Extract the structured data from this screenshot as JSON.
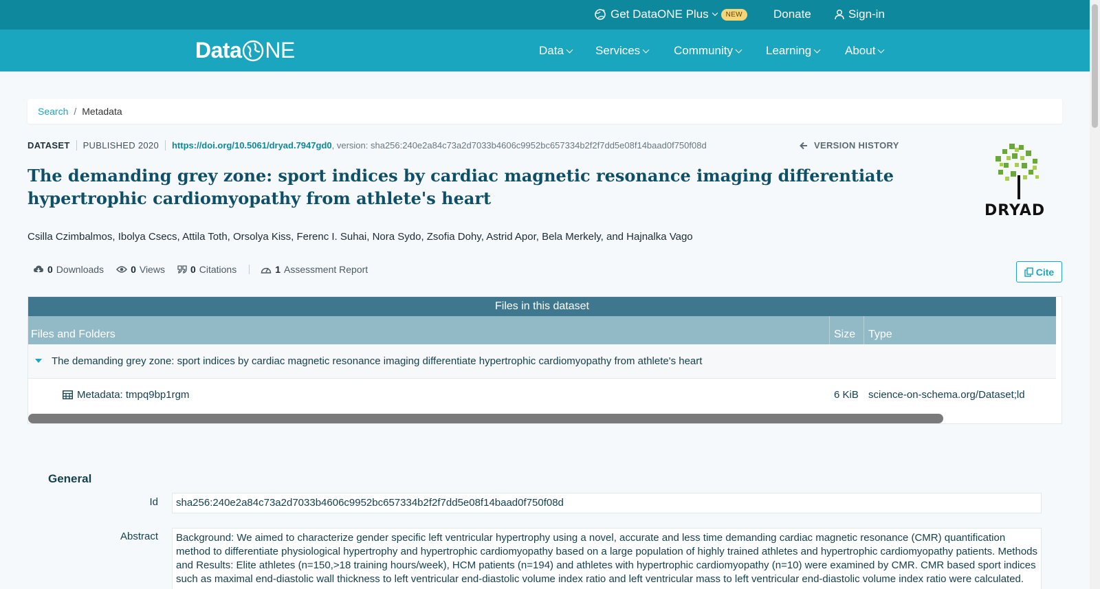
{
  "topbar": {
    "plus_label": "Get DataONE Plus",
    "new_badge": "NEW",
    "donate": "Donate",
    "signin": "Sign-in"
  },
  "nav": {
    "logo_left": "Data",
    "logo_right": "NE",
    "items": [
      "Data",
      "Services",
      "Community",
      "Learning",
      "About"
    ]
  },
  "breadcrumb": {
    "search": "Search",
    "separator": "/",
    "current": "Metadata"
  },
  "dataset": {
    "type": "DATASET",
    "published": "PUBLISHED 2020",
    "doi": "https://doi.org/10.5061/dryad.7947gd0",
    "version": ", version: sha256:240e2a84c73a2d7033b4606c9952bc657334b2f2f7dd5e08f14baad0f750f08d",
    "version_history": "VERSION HISTORY",
    "title": "The demanding grey zone: sport indices by cardiac magnetic resonance imaging differentiate hypertrophic cardiomyopathy from athlete's heart",
    "authors": "Csilla Czimbalmos, Ibolya Csecs, Attila Toth, Orsolya Kiss, Ferenc I. Suhai, Nora Sydo, Zsofia Dohy, Astrid Apor, Bela Merkely, and Hajnalka Vago",
    "repository_logo_text": "DRYAD"
  },
  "metrics": {
    "downloads_count": "0",
    "downloads_label": "Downloads",
    "views_count": "0",
    "views_label": "Views",
    "citations_count": "0",
    "citations_label": "Citations",
    "assessment_count": "1",
    "assessment_label": "Assessment Report",
    "cite_label": "Cite"
  },
  "files": {
    "caption": "Files in this dataset",
    "columns": [
      "Files and Folders",
      "Size",
      "Type"
    ],
    "folder_name": "The demanding grey zone: sport indices by cardiac magnetic resonance imaging differentiate hypertrophic cardiomyopathy from athlete's heart",
    "rows": [
      {
        "name": "Metadata: tmpq9bp1rgm",
        "size": "6 KiB",
        "type": "science-on-schema.org/Dataset;ld"
      }
    ]
  },
  "general": {
    "heading": "General",
    "id_label": "Id",
    "id_value": "sha256:240e2a84c73a2d7033b4606c9952bc657334b2f2f7dd5e08f14baad0f750f08d",
    "abstract_label": "Abstract",
    "abstract_value": "Background: We aimed to characterize gender specific left ventricular hypertrophy using a novel, accurate and less time demanding cardiac magnetic resonance (CMR) quantification method to differentiate physiological hypertrophy and hypertrophic cardiomyopathy based on a large population of highly trained athletes and hypertrophic cardiomyopathy patients. Methods and Results: Elite athletes (n=150,>18 training hours/week), HCM patients (n=194) and athletes with hypertrophic cardiomyopathy (n=10) were examined by CMR. CMR based sport indices such as maximal end-diastolic wall thickness to left ventricular end-diastolic volume index ratio and left ventricular mass to left ventricular end-diastolic volume index ratio were calculated."
  }
}
